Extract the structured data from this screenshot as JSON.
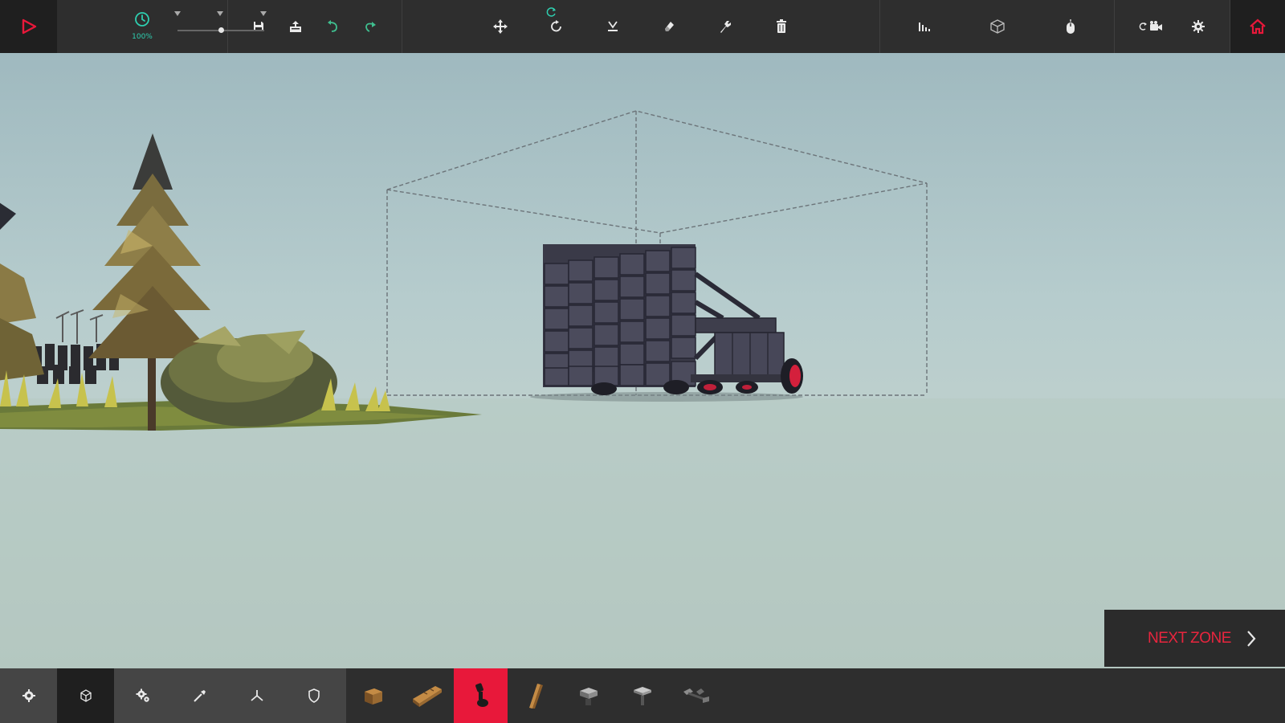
{
  "toolbar": {
    "time_scale_label": "100%",
    "time_scale_value": 0.5,
    "icons": [
      "play-icon",
      "clock-icon",
      "save-icon",
      "load-icon",
      "undo-icon",
      "redo-icon",
      "move-icon",
      "rotate-icon",
      "snap-down-icon",
      "eraser-icon",
      "wrench-icon",
      "trash-icon",
      "stats-icon",
      "cube-outline-icon",
      "mouse-icon",
      "camera-icon",
      "gear-icon",
      "home-icon"
    ]
  },
  "next_zone": {
    "label": "NEXT ZONE"
  },
  "categories": [
    {
      "icon": "core-icon"
    },
    {
      "icon": "cube-icon"
    },
    {
      "icon": "gears-icon"
    },
    {
      "icon": "weapon-icon"
    },
    {
      "icon": "flight-icon"
    },
    {
      "icon": "armour-icon"
    }
  ],
  "blocks": [
    {
      "icon": "wooden-block-icon"
    },
    {
      "icon": "double-wooden-block-icon"
    },
    {
      "icon": "spinning-block-icon"
    },
    {
      "icon": "wooden-pole-icon"
    },
    {
      "icon": "metal-block-icon"
    },
    {
      "icon": "metal-t-block-icon"
    },
    {
      "icon": "brace-icon"
    }
  ],
  "selected_block_index": 2,
  "colors": {
    "accent": "#e8183a",
    "toolbar": "#2e2e2e",
    "time_accent": "#2ecfb0",
    "undo_redo": "#3fbf8f"
  }
}
